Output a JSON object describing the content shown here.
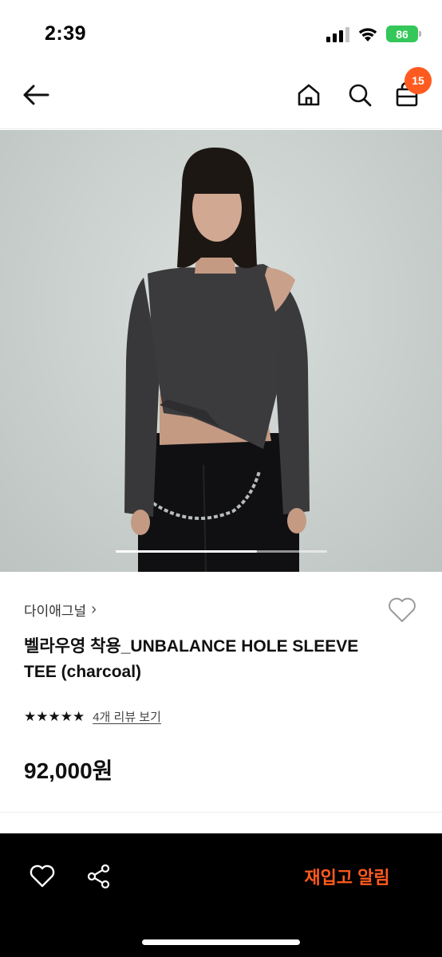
{
  "status_bar": {
    "time": "2:39",
    "battery": "86"
  },
  "nav": {
    "back_icon": "arrow-left-icon",
    "home_icon": "home-icon",
    "search_icon": "search-icon",
    "bag_icon": "shopping-bag-icon",
    "cart_count": "15",
    "badge_color": "#ff5a1f"
  },
  "product": {
    "brand": "다이애그널",
    "brand_chevron": "›",
    "title": "벨라우영 착용_UNBALANCE HOLE SLEEVE TEE (charcoal)",
    "rating_stars": 5,
    "stars_text": "★★★★★",
    "review_link": "4개 리뷰 보기",
    "price": "92,000원",
    "image_page": {
      "current": 1,
      "total": 3
    }
  },
  "bottom_bar": {
    "heart_icon": "heart-outline-icon",
    "share_icon": "share-icon",
    "restock_label": "재입고 알림",
    "accent_color": "#ff5a1f"
  }
}
